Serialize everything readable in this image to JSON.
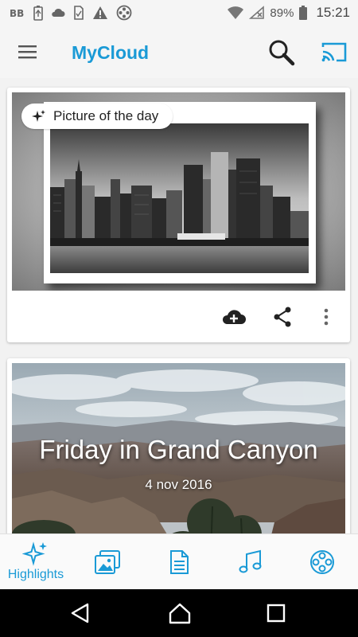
{
  "status_bar": {
    "icons": [
      "bb-icon",
      "battery-saver-icon",
      "cloud-icon",
      "sim-card-icon",
      "warning-icon",
      "film-reel-icon",
      "wifi-icon",
      "signal-off-icon",
      "battery-icon"
    ],
    "battery_percent": "89%",
    "time": "15:21"
  },
  "app_bar": {
    "title": "MyCloud",
    "menu_icon": "hamburger-menu-icon",
    "search_icon": "search-icon",
    "cast_icon": "cast-icon"
  },
  "cards": [
    {
      "chip_label": "Picture of the day",
      "chip_icon": "sparkle-icon",
      "image": "black-and-white-manhattan-skyline-photo",
      "actions": [
        "cloud-upload-icon",
        "share-icon",
        "more-vert-icon"
      ]
    },
    {
      "title": "Friday in Grand Canyon",
      "date": "4 nov 2016",
      "image": "grand-canyon-photo"
    }
  ],
  "tabs": [
    {
      "label": "Highlights",
      "icon": "sparkle-icon",
      "selected": true
    },
    {
      "label": "",
      "icon": "photos-icon"
    },
    {
      "label": "",
      "icon": "document-icon"
    },
    {
      "label": "",
      "icon": "music-note-icon"
    },
    {
      "label": "",
      "icon": "film-reel-icon"
    }
  ],
  "nav_bar": {
    "icons": [
      "back-icon",
      "home-icon",
      "recents-icon"
    ]
  },
  "colors": {
    "accent": "#1a9ad6",
    "app_bar_bg": "#f5f5f5",
    "feed_bg": "#f2f2f2",
    "nav_bar_bg": "#000000"
  }
}
